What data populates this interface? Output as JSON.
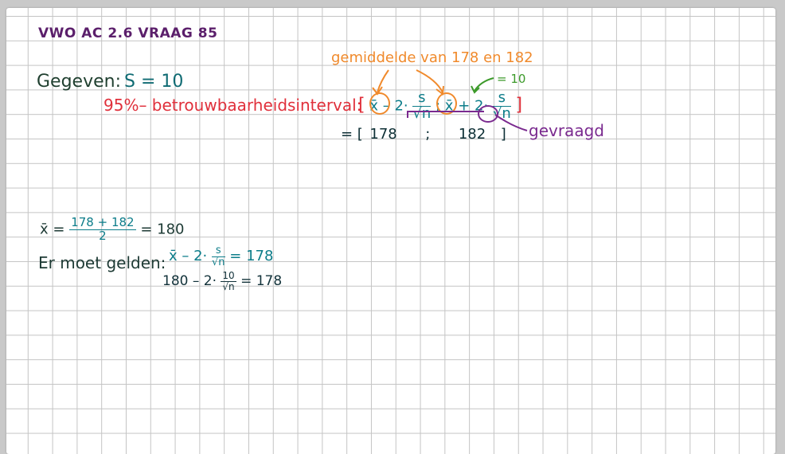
{
  "title": "VWO AC 2.6 VRAAG 85",
  "given": {
    "label": "Gegeven:",
    "s_eq": "S = 10"
  },
  "ci_label": "95%– betrouwbaarheidsinterval:",
  "annotations": {
    "orange": "gemiddelde van 178 en 182",
    "green": "= 10",
    "purple": "gevraagd"
  },
  "ci_formula": {
    "open": "[",
    "xbar1": "x̄",
    "minus_two": "– 2·",
    "frac_num": "s",
    "frac_den": "√n",
    "sep": ";",
    "xbar2": "x̄",
    "plus_two": "+ 2·",
    "close": "]"
  },
  "ci_values": {
    "eq": "= [",
    "lower": "178",
    "sep": ";",
    "upper": "182",
    "close": "]"
  },
  "mean_calc": {
    "xbar": "x̄ =",
    "num": "178 + 182",
    "den": "2",
    "result": "= 180"
  },
  "condition": {
    "label": "Er moet gelden:",
    "eq1_left": "x̄ – 2·",
    "eq1_num": "s",
    "eq1_den": "√n",
    "eq1_right": "= 178",
    "eq2_left": "180 – 2·",
    "eq2_num": "10",
    "eq2_den": "√n",
    "eq2_right": "= 178"
  },
  "colors": {
    "title": "#5b1f6b",
    "red": "#e0303b",
    "orange": "#f08a2c",
    "green": "#3c9a2a",
    "purple": "#7a2a8f",
    "teal": "#0d7d8a"
  }
}
